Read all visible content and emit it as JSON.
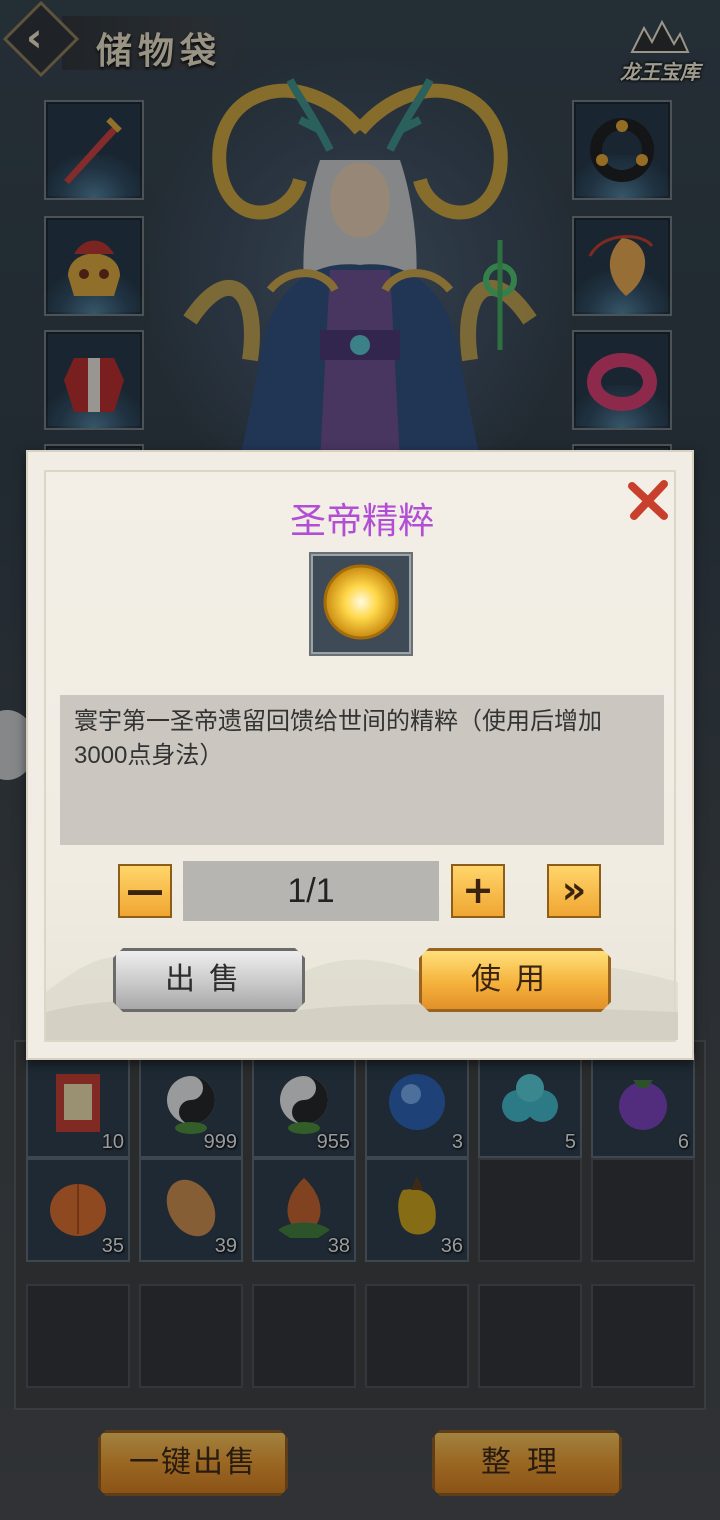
{
  "header": {
    "title": "储物袋",
    "treasury_label": "龙王宝库"
  },
  "equipment": {
    "left_slots": [
      "sword",
      "helmet",
      "armor"
    ],
    "right_slots": [
      "ring-dark",
      "amulet",
      "bracelet"
    ]
  },
  "modal": {
    "title": "圣帝精粹",
    "description": "寰宇第一圣帝遗留回馈给世间的精粹（使用后增加3000点身法）",
    "quantity": "1/1",
    "minus_label": "—",
    "plus_label": "+",
    "max_label": "»",
    "sell_label": "出售",
    "use_label": "使用",
    "title_color": "#b24ed6"
  },
  "inventory": {
    "row1": [
      {
        "icon": "scroll-icon",
        "count": "10"
      },
      {
        "icon": "taiji-seed-icon",
        "count": "999"
      },
      {
        "icon": "taiji-seed-icon",
        "count": "955"
      },
      {
        "icon": "blue-orb-icon",
        "count": "3"
      },
      {
        "icon": "cyan-berries-icon",
        "count": "5"
      },
      {
        "icon": "purple-fruit-icon",
        "count": "6"
      }
    ],
    "row2": [
      {
        "icon": "orange-fruit-icon",
        "count": "35"
      },
      {
        "icon": "brown-seed-icon",
        "count": "39"
      },
      {
        "icon": "bud-fruit-icon",
        "count": "38"
      },
      {
        "icon": "yellow-pepper-icon",
        "count": "36"
      }
    ]
  },
  "bottom": {
    "sell_all_label": "一键出售",
    "sort_label": "整理"
  }
}
